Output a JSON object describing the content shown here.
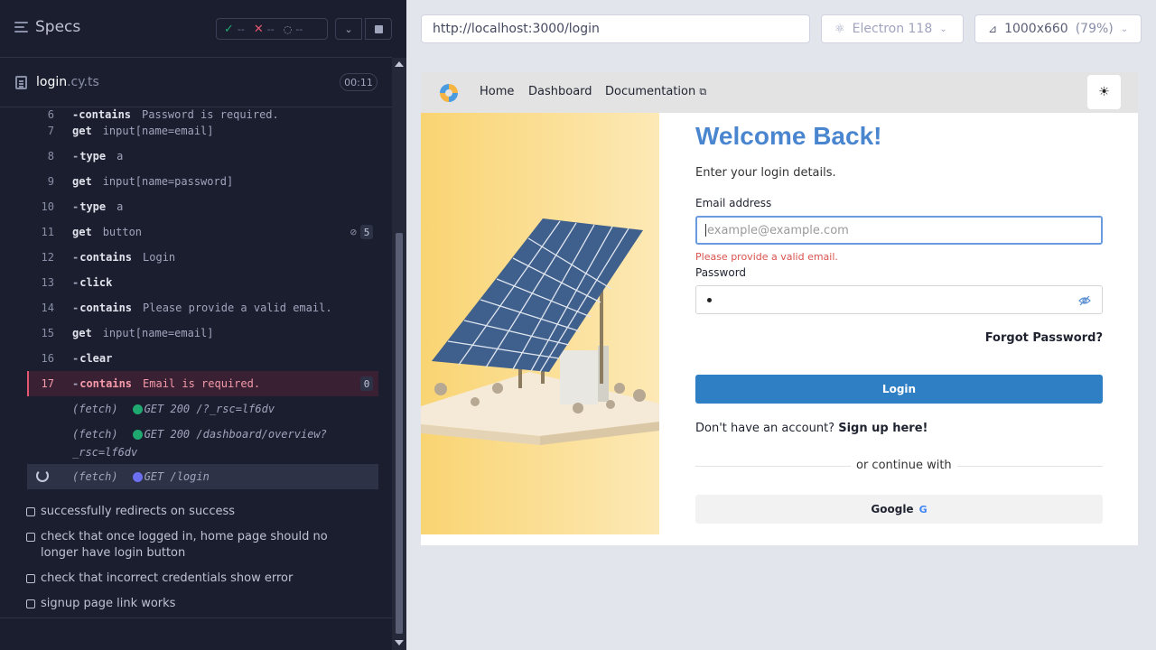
{
  "runner": {
    "specs_label": "Specs",
    "stats": {
      "passed": "--",
      "failed": "--",
      "pending": "--"
    },
    "file": {
      "name": "login",
      "ext": ".cy.ts"
    },
    "timer": "00:11",
    "commands": [
      {
        "num": "7",
        "name": "get",
        "arg": "input[name=email]"
      },
      {
        "num": "8",
        "name": "type",
        "arg": "a"
      },
      {
        "num": "9",
        "name": "get",
        "arg": "input[name=password]"
      },
      {
        "num": "10",
        "name": "type",
        "arg": "a"
      },
      {
        "num": "11",
        "name": "get",
        "arg": "button",
        "badge": "5"
      },
      {
        "num": "12",
        "name": "contains",
        "arg": "Login"
      },
      {
        "num": "13",
        "name": "click",
        "arg": ""
      },
      {
        "num": "14",
        "name": "contains",
        "arg": "Please provide a valid email."
      },
      {
        "num": "15",
        "name": "get",
        "arg": "input[name=email]"
      },
      {
        "num": "16",
        "name": "clear",
        "arg": ""
      },
      {
        "num": "17",
        "name": "contains",
        "arg": "Email is required.",
        "badge": "0"
      }
    ],
    "fetches": [
      {
        "label": "(fetch)",
        "request": "GET 200 /?_rsc=lf6dv",
        "color": "#1fa971"
      },
      {
        "label": "(fetch)",
        "request": "GET 200 /dashboard/overview?",
        "request2": "_rsc=lf6dv",
        "color": "#1fa971"
      },
      {
        "label": "(fetch)",
        "request": "GET /login",
        "color": "#6b6ff0"
      }
    ],
    "tests": [
      "successfully redirects on success",
      "check that once logged in, home page should no longer have login button",
      "check that incorrect credentials show error",
      "signup page link works"
    ]
  },
  "browser": {
    "url": "http://localhost:3000/login",
    "browser_name": "Electron 118",
    "viewport": "1000x660",
    "zoom": "(79%)"
  },
  "app": {
    "nav": {
      "home": "Home",
      "dashboard": "Dashboard",
      "documentation": "Documentation"
    },
    "title": "Welcome Back!",
    "subtitle": "Enter your login details.",
    "email_label": "Email address",
    "email_placeholder": "example@example.com",
    "email_error": "Please provide a valid email.",
    "password_label": "Password",
    "forgot": "Forgot Password?",
    "login_button": "Login",
    "signup_prompt": "Don't have an account?",
    "signup_link": "Sign up here!",
    "divider_text": "or continue with",
    "google_button": "Google",
    "colors": {
      "accent": "#2f7fc4",
      "title": "#4a86cf",
      "error": "#d9534f"
    }
  }
}
